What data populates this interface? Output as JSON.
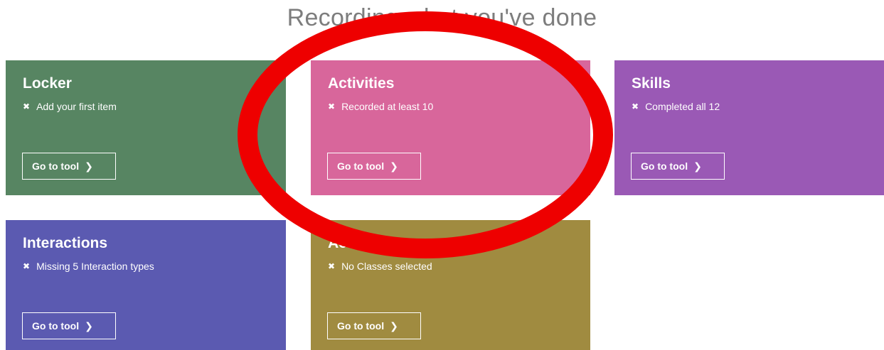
{
  "page": {
    "title": "Recording what you've done"
  },
  "cards": [
    {
      "title": "Locker",
      "status": "Add your first item",
      "button": "Go to tool",
      "color": "#578562"
    },
    {
      "title": "Activities",
      "status": "Recorded at least 10",
      "button": "Go to tool",
      "color": "#d8669b"
    },
    {
      "title": "Skills",
      "status": "Completed all 12",
      "button": "Go to tool",
      "color": "#9a59b5"
    },
    {
      "title": "Interactions",
      "status": "Missing 5 Interaction types",
      "button": "Go to tool",
      "color": "#5b5ab1"
    },
    {
      "title": "Academics",
      "status": "No Classes selected",
      "button": "Go to tool",
      "color": "#a08b40"
    }
  ],
  "icons": {
    "status": "close-icon",
    "button": "chevron-right-icon"
  },
  "annotation": {
    "color": "#ee0000"
  }
}
